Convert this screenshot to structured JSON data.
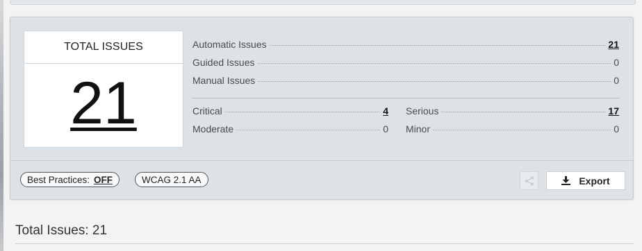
{
  "total": {
    "title": "TOTAL ISSUES",
    "count": "21"
  },
  "issue_types": [
    {
      "label": "Automatic Issues",
      "value": "21"
    },
    {
      "label": "Guided Issues",
      "value": "0"
    },
    {
      "label": "Manual Issues",
      "value": "0"
    }
  ],
  "severity": {
    "critical": {
      "label": "Critical",
      "value": "4"
    },
    "serious": {
      "label": "Serious",
      "value": "17"
    },
    "moderate": {
      "label": "Moderate",
      "value": "0"
    },
    "minor": {
      "label": "Minor",
      "value": "0"
    }
  },
  "footer": {
    "best_practices_label": "Best Practices:",
    "best_practices_value": "OFF",
    "standard": "WCAG 2.1 AA",
    "export_label": "Export",
    "share_icon": "share-icon",
    "export_icon": "download-icon"
  },
  "summary_heading": "Total Issues: 21",
  "colors": {
    "panel_bg": "#dde2e6",
    "link_text": "#111111"
  }
}
